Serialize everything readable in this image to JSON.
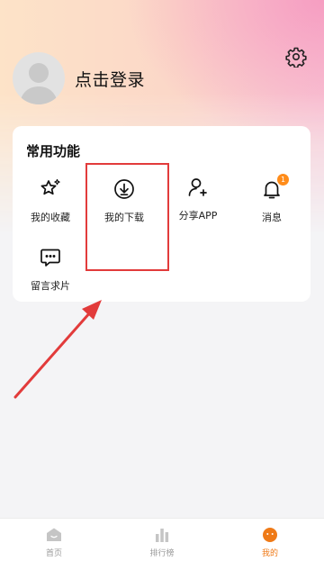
{
  "header": {
    "login_text": "点击登录"
  },
  "functions": {
    "title": "常用功能",
    "items": [
      {
        "label": "我的收藏",
        "icon": "star-sparkle-icon"
      },
      {
        "label": "我的下载",
        "icon": "download-icon"
      },
      {
        "label": "分享APP",
        "icon": "add-user-icon"
      },
      {
        "label": "消息",
        "icon": "bell-icon",
        "badge": "1"
      },
      {
        "label": "留言求片",
        "icon": "message-icon"
      }
    ]
  },
  "tabbar": {
    "items": [
      {
        "label": "首页",
        "icon": "home-icon",
        "active": false
      },
      {
        "label": "排行榜",
        "icon": "chart-bar-icon",
        "active": false
      },
      {
        "label": "我的",
        "icon": "profile-face-icon",
        "active": true
      }
    ]
  },
  "colors": {
    "accent": "#ef7a17",
    "highlight": "#e23b3b",
    "badge": "#ff8c1a"
  }
}
